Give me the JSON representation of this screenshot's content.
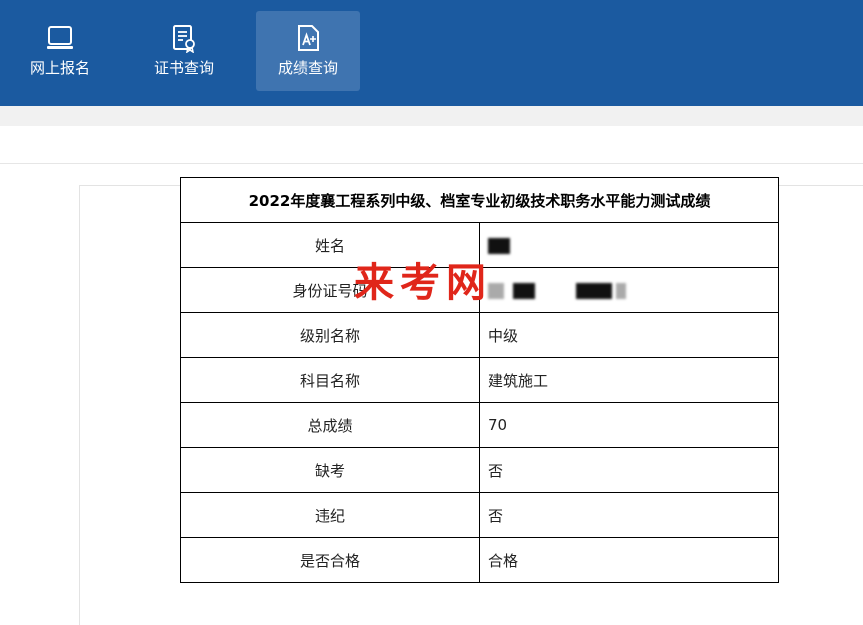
{
  "nav": {
    "items": [
      {
        "label": "网上报名",
        "icon": "laptop-icon"
      },
      {
        "label": "证书查询",
        "icon": "certificate-icon"
      },
      {
        "label": "成绩查询",
        "icon": "score-icon",
        "active": true
      }
    ]
  },
  "result": {
    "title": "2022年度襄工程系列中级、档室专业初级技术职务水平能力测试成绩",
    "rows": [
      {
        "label": "姓名",
        "value": ""
      },
      {
        "label": "身份证号码",
        "value": ""
      },
      {
        "label": "级别名称",
        "value": "中级"
      },
      {
        "label": "科目名称",
        "value": "建筑施工"
      },
      {
        "label": "总成绩",
        "value": "70"
      },
      {
        "label": "缺考",
        "value": "否"
      },
      {
        "label": "违纪",
        "value": "否"
      },
      {
        "label": "是否合格",
        "value": "合格"
      }
    ]
  },
  "watermark": "来考网",
  "colors": {
    "nav_bg": "#1b5aa0",
    "nav_active": "#3f74b0",
    "watermark": "#e0261a"
  }
}
